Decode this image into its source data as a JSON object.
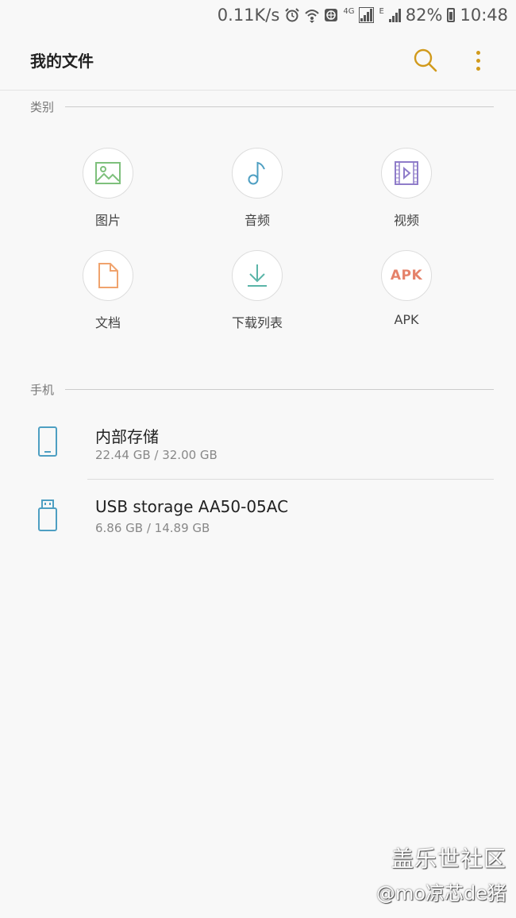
{
  "status_bar": {
    "speed": "0.11K/s",
    "network_4g": "4G",
    "network_e": "E",
    "battery": "82%",
    "time": "10:48",
    "icons": [
      "alarm-icon",
      "wifi-icon",
      "vpn-icon",
      "signal-icon",
      "signal-icon",
      "battery-icon"
    ]
  },
  "app_bar": {
    "title": "我的文件",
    "search_icon": "search-icon",
    "more_icon": "more-vert-icon",
    "accent_color": "#d19a1c"
  },
  "categories": {
    "header": "类别",
    "items": [
      {
        "label": "图片",
        "icon": "image-icon",
        "color": "#7ec07c"
      },
      {
        "label": "音频",
        "icon": "music-note-icon",
        "color": "#4e9fc2"
      },
      {
        "label": "视频",
        "icon": "video-icon",
        "color": "#8f7cc9"
      },
      {
        "label": "文档",
        "icon": "document-icon",
        "color": "#f0a36d"
      },
      {
        "label": "下载列表",
        "icon": "download-icon",
        "color": "#5ab5a8"
      },
      {
        "label": "APK",
        "icon": "apk-icon",
        "icon_text": "APK",
        "color": "#e5826a"
      }
    ]
  },
  "phone": {
    "header": "手机",
    "storage": [
      {
        "name": "内部存储",
        "size": "22.44 GB / 32.00 GB",
        "icon": "phone-icon"
      },
      {
        "name": "USB storage AA50-05AC",
        "size": "6.86 GB / 14.89 GB",
        "icon": "usb-icon"
      }
    ],
    "icon_color": "#4e9fc2"
  },
  "watermark": {
    "line1": "盖乐世社区",
    "line2": "@mo凉芯de猪"
  }
}
